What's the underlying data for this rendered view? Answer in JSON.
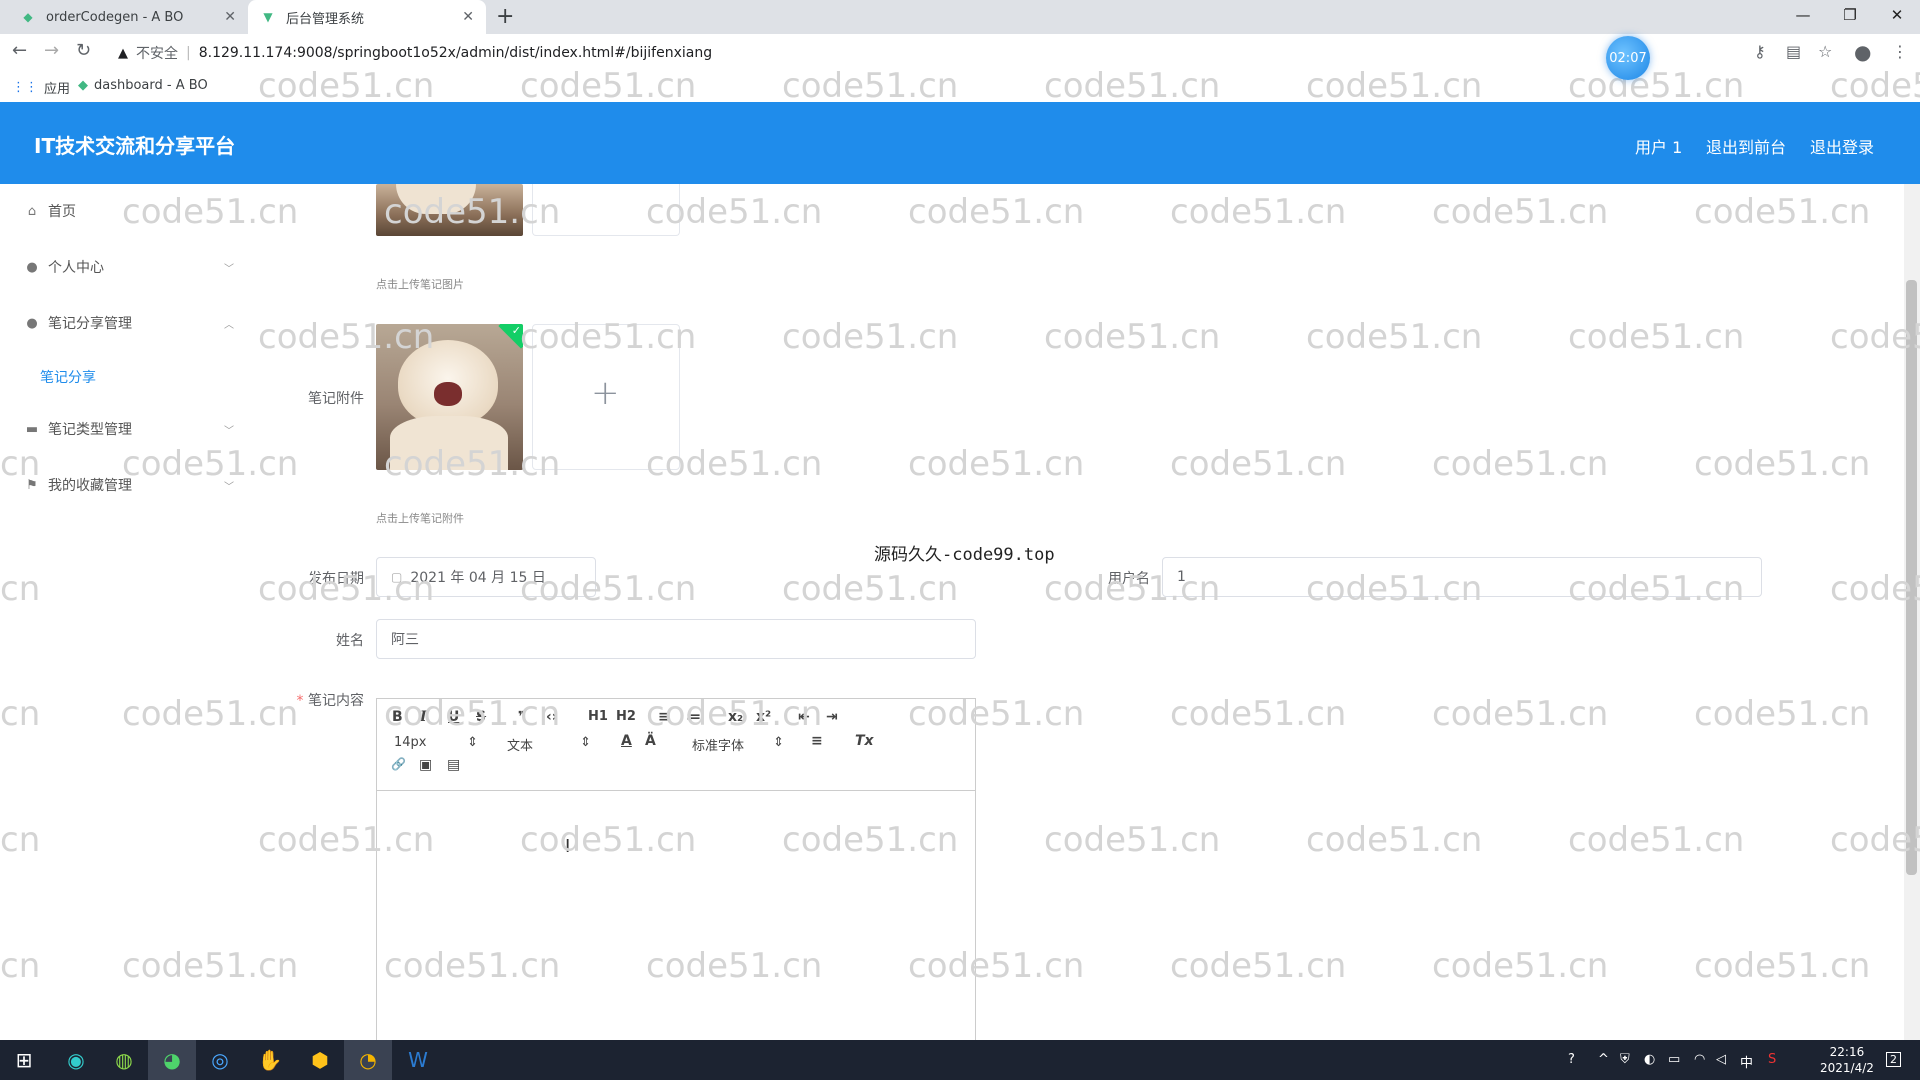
{
  "browser": {
    "tabs": [
      {
        "title": "orderCodegen - A BO",
        "favicon": "vue-icon"
      },
      {
        "title": "后台管理系统",
        "favicon": "vue-icon"
      }
    ],
    "new_tab": "+",
    "address": {
      "warning": "▲",
      "insecure": "不安全",
      "separator": "|",
      "url": "8.129.11.174:9008/springboot1o52x/admin/dist/index.html#/bijifenxiang"
    },
    "timer": "02:07",
    "bookmarks": [
      {
        "label": "应用"
      },
      {
        "label": "dashboard - A BO"
      }
    ]
  },
  "app": {
    "title": "IT技术交流和分享平台",
    "header_links": [
      "用户 1",
      "退出到前台",
      "退出登录"
    ]
  },
  "sidebar": {
    "items": [
      {
        "label": "首页",
        "icon": "home-icon"
      },
      {
        "label": "个人中心",
        "icon": "user-icon"
      },
      {
        "label": "笔记分享管理",
        "icon": "user-icon"
      },
      {
        "label": "笔记类型管理",
        "icon": "folder-icon"
      },
      {
        "label": "我的收藏管理",
        "icon": "flag-icon"
      }
    ],
    "submenu": {
      "label": "笔记分享"
    }
  },
  "form": {
    "image_hint": "点击上传笔记图片",
    "attachment_label": "笔记附件",
    "attachment_hint": "点击上传笔记附件",
    "date_label": "发布日期",
    "date_value": "2021 年 04 月 15 日",
    "username_label": "用户名",
    "username_value": "1",
    "name_label": "姓名",
    "name_value": "阿三",
    "content_required": "*",
    "content_label": "笔记内容"
  },
  "center_note": "源码久久-code99.top",
  "editor": {
    "toolbar_row1": [
      "B",
      "I",
      "U",
      "S",
      "❞",
      "‹›",
      "H1",
      "H2",
      "≡",
      "≔",
      "x₂",
      "x²",
      "⇤",
      "⇥"
    ],
    "font_size": "14px",
    "block_type": "文本",
    "font_family": "标准字体",
    "toolbar_row2_icons": [
      "A",
      "Ä",
      "≡",
      "Tx"
    ],
    "toolbar_row3_icons": [
      "🔗",
      "▣",
      "▤"
    ]
  },
  "watermark": "code51.cn",
  "taskbar": {
    "time": "22:16",
    "date": "2021/4/2",
    "ime": "中",
    "notifications": "2"
  },
  "colors": {
    "primary": "#1f8ceb",
    "taskbar": "#1c2331"
  }
}
